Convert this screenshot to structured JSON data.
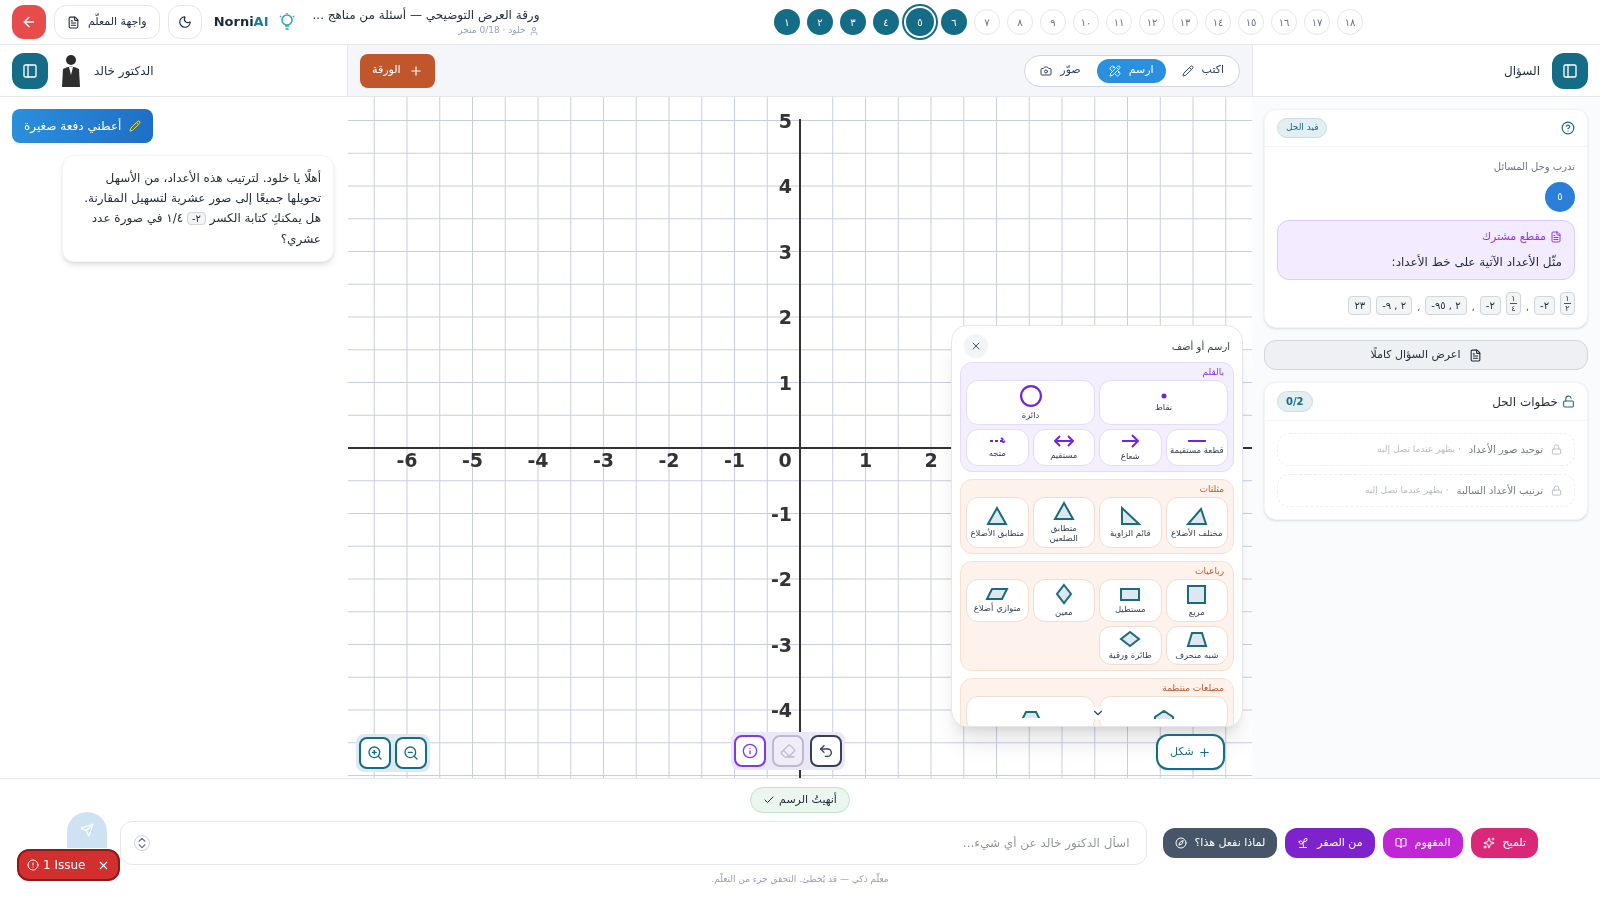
{
  "topbar": {
    "title": "ورقة العرض التوضيحي — أسئلة من مناهج ...",
    "subtitle": "خلود · 0/18 متجر",
    "logo": {
      "name": "Norni",
      "accent": "AI"
    },
    "teacher_button": "واجهة المعلّم"
  },
  "steps": [
    {
      "label": "١٨",
      "done": false,
      "selected": false
    },
    {
      "label": "١٧",
      "done": false,
      "selected": false
    },
    {
      "label": "١٦",
      "done": false,
      "selected": false
    },
    {
      "label": "١٥",
      "done": false,
      "selected": false
    },
    {
      "label": "١٤",
      "done": false,
      "selected": false
    },
    {
      "label": "١٣",
      "done": false,
      "selected": false
    },
    {
      "label": "١٢",
      "done": false,
      "selected": false
    },
    {
      "label": "١١",
      "done": false,
      "selected": false
    },
    {
      "label": "١٠",
      "done": false,
      "selected": false
    },
    {
      "label": "٩",
      "done": false,
      "selected": false
    },
    {
      "label": "٨",
      "done": false,
      "selected": false
    },
    {
      "label": "٧",
      "done": false,
      "selected": false
    },
    {
      "label": "٦",
      "done": true,
      "selected": false
    },
    {
      "label": "٥",
      "done": true,
      "selected": true
    },
    {
      "label": "٤",
      "done": true,
      "selected": false
    },
    {
      "label": "٣",
      "done": true,
      "selected": false
    },
    {
      "label": "٢",
      "done": true,
      "selected": false
    },
    {
      "label": "١",
      "done": true,
      "selected": false
    }
  ],
  "tutor": {
    "name": "الدكتور خالد",
    "nudge_button": "أعطني دفعة صغيرة",
    "message": {
      "before": "أهلًا يا خلود. لترتيب هذه الأعداد، من الأسهل تحويلها جميعًا إلى صور عشرية لتسهيل المقارنة. هل يمكنكِ كتابة الكسر",
      "chip": "-٢",
      "after": "١/٤ في صورة عدد عشري؟"
    }
  },
  "toolbar": {
    "sheet_button": "الورقة",
    "modes": [
      {
        "label": "اكتب",
        "selected": false
      },
      {
        "label": "ارسم",
        "selected": true
      },
      {
        "label": "صوّر",
        "selected": false
      }
    ]
  },
  "canvas": {
    "x_labels": [
      "2",
      "1",
      "0",
      "-1",
      "-2",
      "-3",
      "-4",
      "-5",
      "-6"
    ],
    "y_labels": [
      "5",
      "4",
      "3",
      "2",
      "1",
      "-1",
      "-2",
      "-3",
      "-4"
    ],
    "shape_button": "شكل",
    "tools": [
      {
        "kind": "undo",
        "selected": false,
        "disabled": false
      },
      {
        "kind": "eraser",
        "selected": false,
        "disabled": true
      },
      {
        "kind": "info",
        "selected": true,
        "disabled": false
      }
    ]
  },
  "shape_panel": {
    "title": "ارسم أو أضف",
    "sections": [
      {
        "title": "بالقلم",
        "items": [
          {
            "kind": "dot",
            "label": "نقاط",
            "wide": true
          },
          {
            "kind": "circle",
            "label": "دائرة",
            "wide": true
          },
          {
            "kind": "segment",
            "label": "قطعة مستقيمة",
            "wide": false
          },
          {
            "kind": "ray",
            "label": "شعاع",
            "wide": false
          },
          {
            "kind": "line",
            "label": "مستقيم",
            "wide": false
          },
          {
            "kind": "vector",
            "label": "متجه",
            "wide": false
          }
        ]
      },
      {
        "title": "مثلثات",
        "items": [
          {
            "kind": "scalene",
            "label": "مختلف الأضلاع",
            "wide": false
          },
          {
            "kind": "right",
            "label": "قائم الزاوية",
            "wide": false
          },
          {
            "kind": "isosceles",
            "label": "متطابق الضلعين",
            "wide": false
          },
          {
            "kind": "equilateral",
            "label": "متطابق الأضلاع",
            "wide": false
          }
        ]
      },
      {
        "title": "رباعيات",
        "items": [
          {
            "kind": "square",
            "label": "مربع",
            "wide": false
          },
          {
            "kind": "rectangle",
            "label": "مستطيل",
            "wide": false
          },
          {
            "kind": "rhombus",
            "label": "معين",
            "wide": false
          },
          {
            "kind": "parallelogram",
            "label": "متوازي أضلاع",
            "wide": false
          },
          {
            "kind": "trapezoid",
            "label": "شبه منحرف",
            "wide": false
          },
          {
            "kind": "kite",
            "label": "طائرة ورقية",
            "wide": false
          }
        ]
      },
      {
        "title": "مضلعات منتظمة",
        "items": [
          {
            "kind": "pentagon",
            "wide": true
          },
          {
            "kind": "hexagon",
            "wide": true
          }
        ]
      }
    ]
  },
  "question": {
    "title": "السؤال",
    "status": "قيد الحل",
    "category": "تدرب وحل المسائل",
    "number": "٥",
    "passage": {
      "title": "مقطع مشترك",
      "text": "مثّل الأعداد الآتية على خط الأعداد:"
    },
    "tokens": [
      {
        "kind": "fraction",
        "num": "١",
        "den": "٢"
      },
      {
        "kind": "chip",
        "text": "-٢"
      },
      {
        "kind": "sep",
        "text": "،"
      },
      {
        "kind": "fraction",
        "num": "١",
        "den": "٤"
      },
      {
        "kind": "chip",
        "text": "-٢"
      },
      {
        "kind": "sep",
        "text": "،"
      },
      {
        "kind": "chip",
        "text": "-٢ , ٩٥"
      },
      {
        "kind": "sep",
        "text": "،"
      },
      {
        "kind": "chip",
        "text": "-٢ , ٩"
      },
      {
        "kind": "chip",
        "text": "٢٣"
      }
    ],
    "show_full_button": "اعرض السؤال كاملًا"
  },
  "solution_steps": {
    "title": "خطوات الحل",
    "progress": "0/2",
    "items": [
      {
        "title": "توحيد صور الأعداد",
        "hint": "· يظهر عندما تصل إليه",
        "locked": true
      },
      {
        "title": "ترتيب الأعداد السالبة",
        "hint": "· يظهر عندما تصل إليه",
        "locked": true
      }
    ]
  },
  "bottom": {
    "done_chip": "أنهيتُ الرسم",
    "input_placeholder": "اسألِ الدكتور خالد عن أي شيء...",
    "actions": [
      {
        "label": "تلميح",
        "color": "#db2777"
      },
      {
        "label": "المفهوم",
        "color": "#c026d3"
      },
      {
        "label": "من الصفر",
        "color": "#7e22ce"
      },
      {
        "label": "لماذا نفعل هذا؟",
        "color": "#475569"
      }
    ],
    "footer": "معلّم ذكي — قد يُخطئ. التحقق جزء من التعلّم.",
    "issue_badge": "1 Issue"
  }
}
